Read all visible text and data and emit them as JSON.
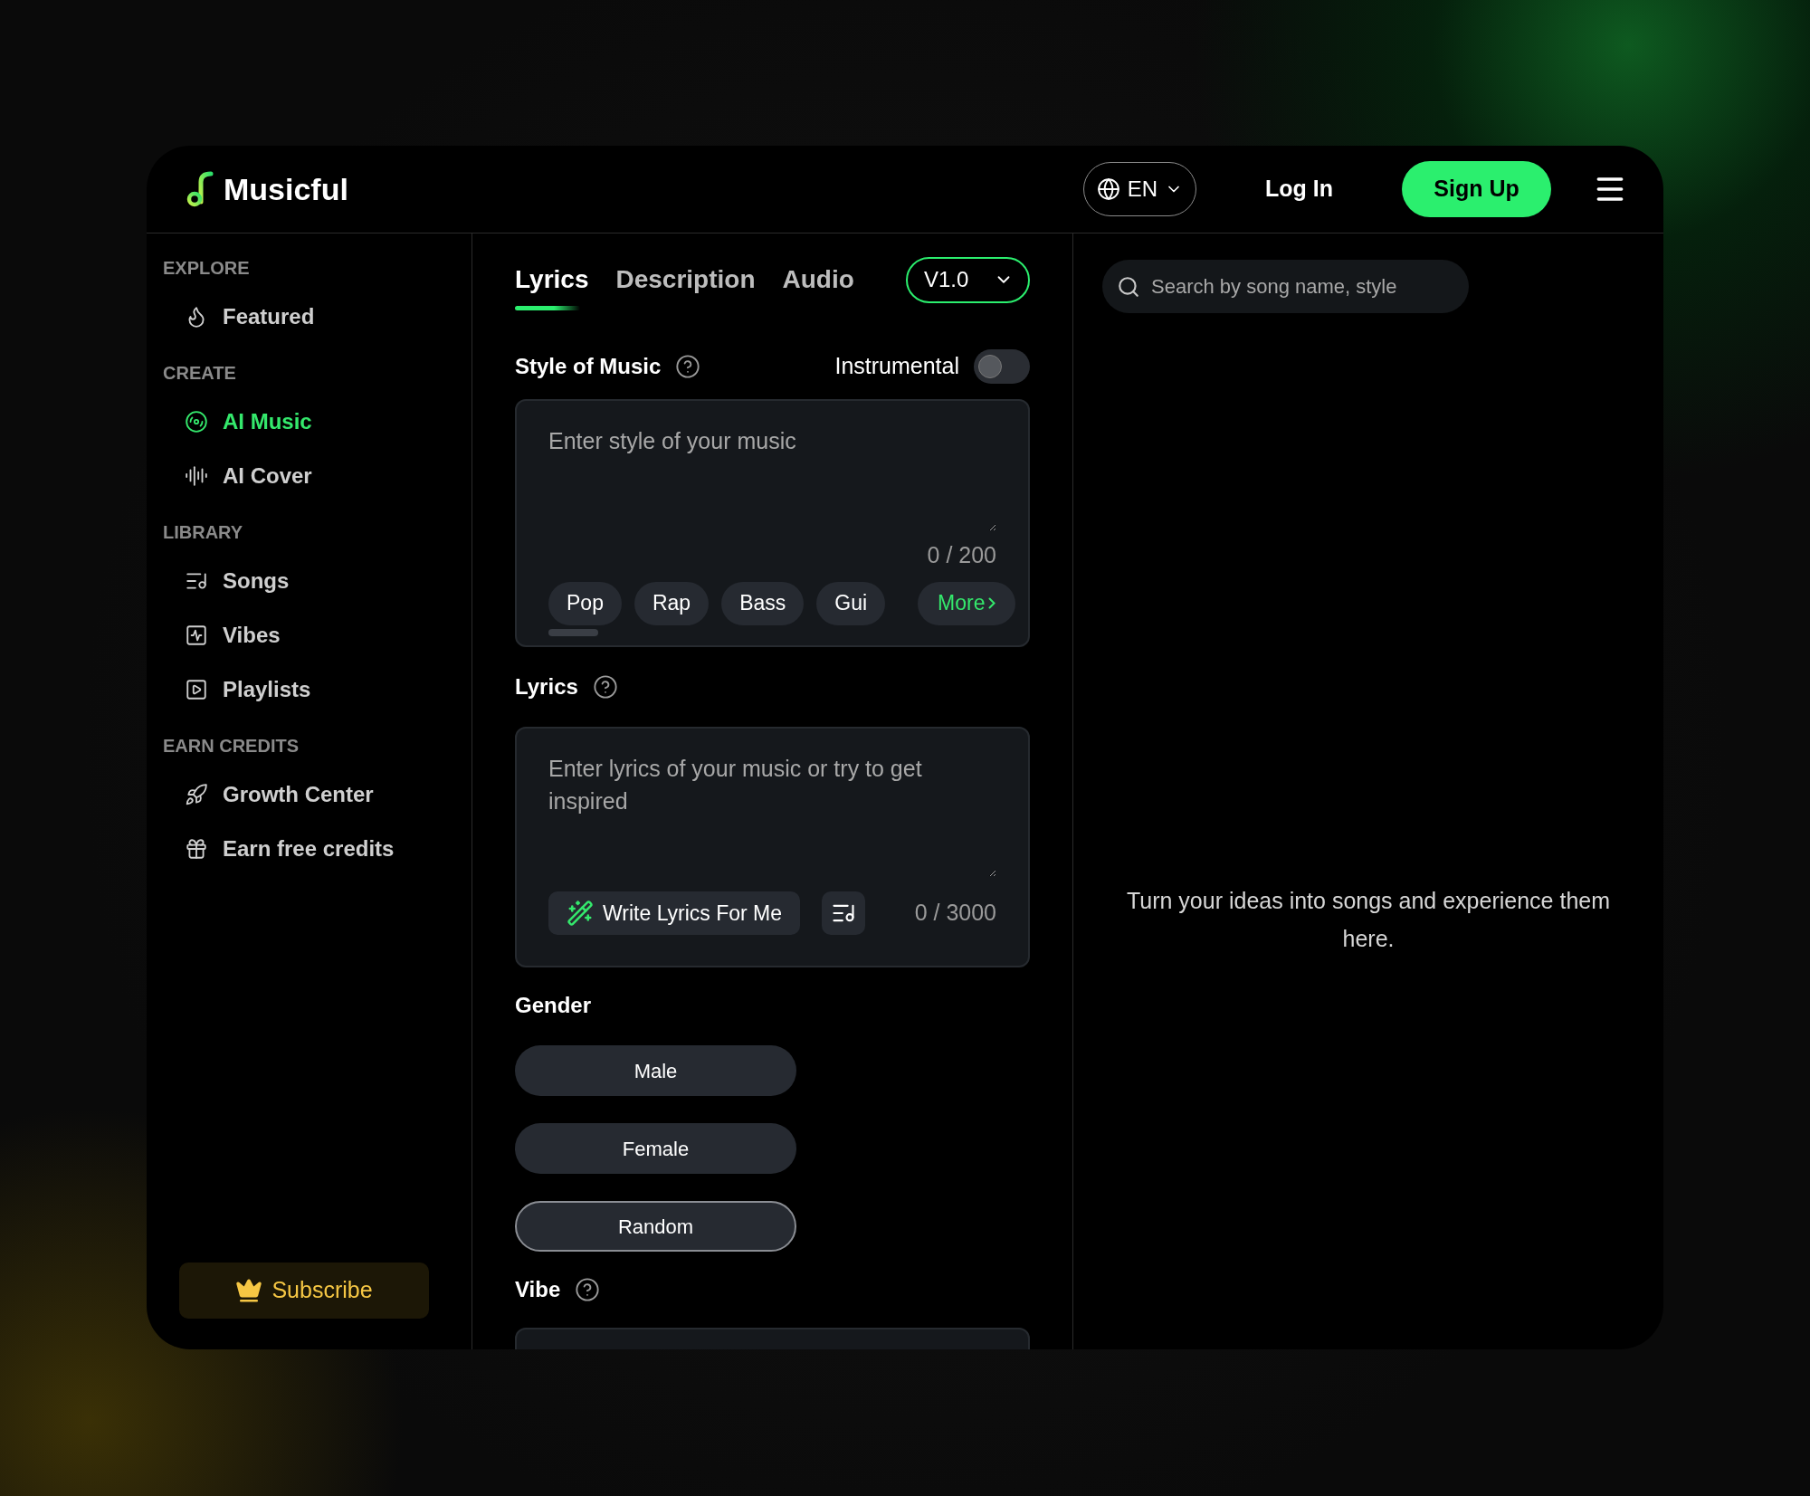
{
  "brand": {
    "name": "Musicful"
  },
  "header": {
    "language": "EN",
    "login": "Log In",
    "signup": "Sign Up"
  },
  "sidebar": {
    "sections": [
      {
        "heading": "EXPLORE",
        "items": [
          {
            "label": "Featured",
            "selected": false
          }
        ]
      },
      {
        "heading": "CREATE",
        "items": [
          {
            "label": "AI Music",
            "selected": true
          },
          {
            "label": "AI Cover",
            "selected": false
          }
        ]
      },
      {
        "heading": "LIBRARY",
        "items": [
          {
            "label": "Songs",
            "selected": false
          },
          {
            "label": "Vibes",
            "selected": false
          },
          {
            "label": "Playlists",
            "selected": false
          }
        ]
      },
      {
        "heading": "EARN CREDITS",
        "items": [
          {
            "label": "Growth Center",
            "selected": false
          },
          {
            "label": "Earn free credits",
            "selected": false
          }
        ]
      }
    ],
    "subscribe": "Subscribe"
  },
  "tabs": [
    {
      "label": "Lyrics",
      "selected": true
    },
    {
      "label": "Description",
      "selected": false
    },
    {
      "label": "Audio",
      "selected": false
    }
  ],
  "version": "V1.0",
  "style": {
    "label": "Style of Music",
    "instrumental": {
      "label": "Instrumental",
      "on": false
    },
    "placeholder": "Enter style of your music",
    "counter": "0 / 200",
    "tags": [
      "Pop",
      "Rap",
      "Bass",
      "Gui"
    ],
    "more": "More"
  },
  "lyrics": {
    "label": "Lyrics",
    "placeholder": "Enter lyrics of your music or try to get inspired",
    "write_button": "Write Lyrics For Me",
    "counter": "0 / 3000"
  },
  "gender": {
    "label": "Gender",
    "options": [
      {
        "label": "Male",
        "selected": false
      },
      {
        "label": "Female",
        "selected": false
      },
      {
        "label": "Random",
        "selected": true
      }
    ]
  },
  "vibe": {
    "label": "Vibe"
  },
  "search": {
    "placeholder": "Search by song name, style"
  },
  "empty_message": "Turn your ideas into songs and experience them here."
}
